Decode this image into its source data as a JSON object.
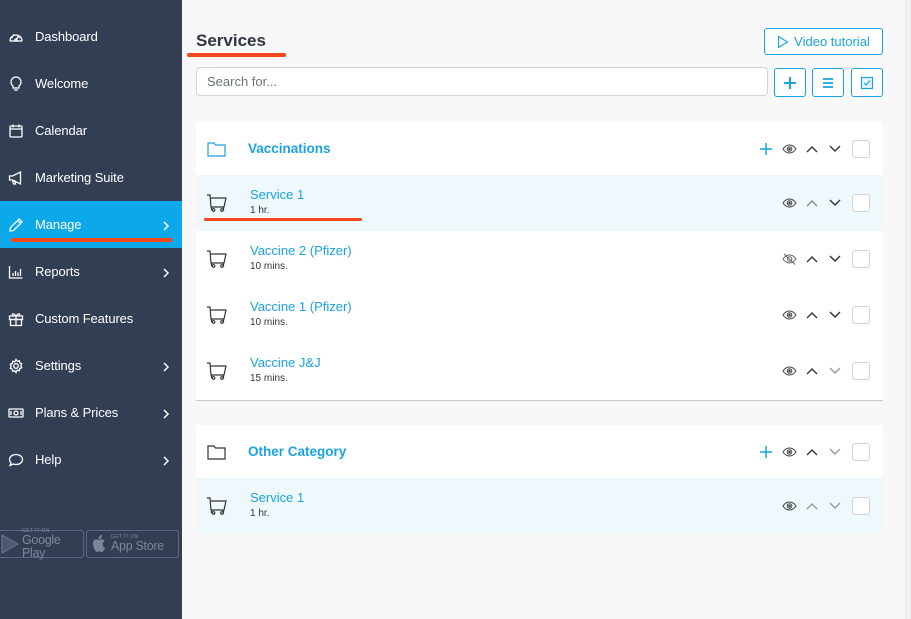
{
  "sidebar": {
    "items": [
      {
        "label": "Dashboard",
        "icon": "dashboard-gauge-icon",
        "has_submenu": false,
        "active": false
      },
      {
        "label": "Welcome",
        "icon": "lightbulb-icon",
        "has_submenu": false,
        "active": false
      },
      {
        "label": "Calendar",
        "icon": "calendar-icon",
        "has_submenu": false,
        "active": false
      },
      {
        "label": "Marketing Suite",
        "icon": "megaphone-icon",
        "has_submenu": false,
        "active": false
      },
      {
        "label": "Manage",
        "icon": "pencil-icon",
        "has_submenu": true,
        "active": true
      },
      {
        "label": "Reports",
        "icon": "bar-chart-icon",
        "has_submenu": true,
        "active": false
      },
      {
        "label": "Custom Features",
        "icon": "gift-icon",
        "has_submenu": false,
        "active": false
      },
      {
        "label": "Settings",
        "icon": "gear-icon",
        "has_submenu": true,
        "active": false
      },
      {
        "label": "Plans & Prices",
        "icon": "money-icon",
        "has_submenu": true,
        "active": false
      },
      {
        "label": "Help",
        "icon": "chat-bubble-icon",
        "has_submenu": true,
        "active": false
      }
    ],
    "store_badges": {
      "google": {
        "small": "GET IT ON",
        "big": "Google Play"
      },
      "apple": {
        "small": "GET IT ON",
        "big": "App Store"
      }
    }
  },
  "header": {
    "title": "Services",
    "video_tutorial_label": "Video tutorial"
  },
  "search": {
    "placeholder": "Search for...",
    "value": ""
  },
  "toolbar": {
    "add_icon": "plus-icon",
    "list_icon": "list-icon",
    "select_icon": "checkbox-icon"
  },
  "categories": [
    {
      "name": "Vaccinations",
      "services": [
        {
          "name": "Service 1",
          "duration": "1 hr.",
          "visible": true,
          "highlighted": true
        },
        {
          "name": "Vaccine 2 (Pfizer)",
          "duration": "10 mins.",
          "visible": false,
          "highlighted": false
        },
        {
          "name": "Vaccine 1 (Pfizer)",
          "duration": "10 mins.",
          "visible": true,
          "highlighted": false
        },
        {
          "name": "Vaccine J&J",
          "duration": "15 mins.",
          "visible": true,
          "highlighted": false
        }
      ]
    },
    {
      "name": "Other Category",
      "services": [
        {
          "name": "Service 1",
          "duration": "1 hr.",
          "visible": true,
          "highlighted": true
        }
      ]
    }
  ],
  "colors": {
    "sidebar_bg": "#323e54",
    "active_nav": "#0ba8ea",
    "accent": "#1aa3e0",
    "annotation_underline": "#f2461b",
    "highlight_row": "#eff8fc"
  }
}
